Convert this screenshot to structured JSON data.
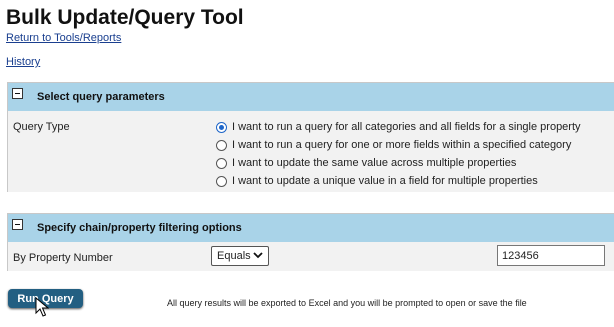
{
  "page": {
    "title": "Bulk Update/Query Tool",
    "return_link": "Return to Tools/Reports",
    "history_link": "History"
  },
  "query_panel": {
    "title": "Select query parameters",
    "query_type_label": "Query Type",
    "options": [
      {
        "label": "I want to run a query for all categories and all fields for a single property",
        "checked": true
      },
      {
        "label": "I want to run a query for one or more fields within a specified category",
        "checked": false
      },
      {
        "label": "I want to update the same value across multiple properties",
        "checked": false
      },
      {
        "label": "I want to update a unique value in a field for multiple properties",
        "checked": false
      }
    ]
  },
  "filter_panel": {
    "title": "Specify chain/property filtering options",
    "property_label": "By Property Number",
    "operator_value": "Equals",
    "property_value": "123456"
  },
  "actions": {
    "run_label": "Run Query",
    "notice": "All query results will be exported to Excel and you will be prompted to open or save the file"
  },
  "colors": {
    "header_bg": "#a9d3e8",
    "panel_bg": "#f2f2f2",
    "button_bg": "#235f82",
    "radio_accent": "#1e66c9"
  }
}
